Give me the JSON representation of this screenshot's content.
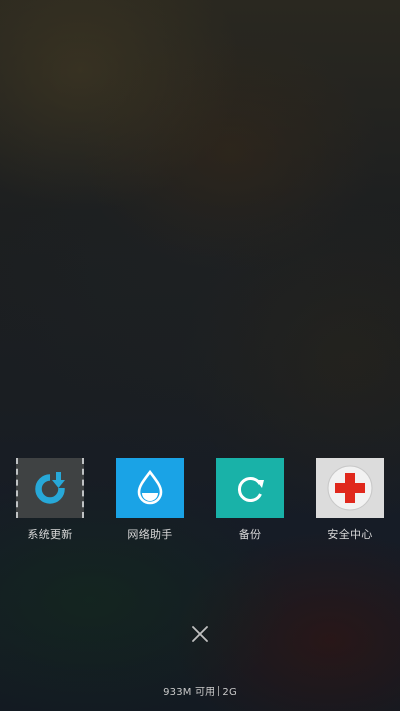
{
  "apps": [
    {
      "label": "系统更新",
      "icon": "refresh-arrow-icon",
      "color": "#3f4243"
    },
    {
      "label": "网络助手",
      "icon": "water-drop-icon",
      "color": "#1aa3e6"
    },
    {
      "label": "备份",
      "icon": "sync-circle-icon",
      "color": "#19b2a8"
    },
    {
      "label": "安全中心",
      "icon": "red-cross-icon",
      "color": "#dcdcdc"
    }
  ],
  "close_button": {
    "icon": "close-icon"
  },
  "memory": {
    "available": "933M 可用",
    "total": "2G"
  }
}
